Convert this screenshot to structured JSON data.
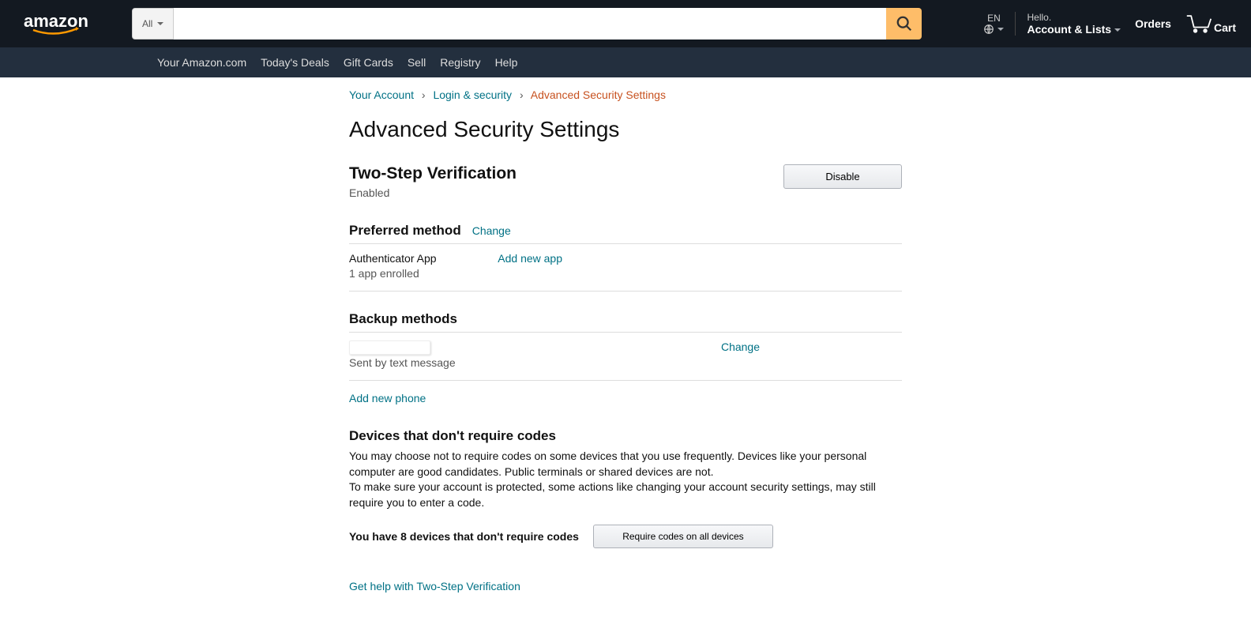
{
  "header": {
    "logo_text": "amazon",
    "search_scope": "All",
    "search_placeholder": "",
    "lang_code": "EN",
    "account_line1": "Hello.",
    "account_line2": "Account & Lists",
    "orders": "Orders",
    "cart": "Cart"
  },
  "subnav": {
    "items": [
      "Your Amazon.com",
      "Today's Deals",
      "Gift Cards",
      "Sell",
      "Registry",
      "Help"
    ]
  },
  "breadcrumb": {
    "your_account": "Your Account",
    "login_security": "Login & security",
    "current": "Advanced Security Settings"
  },
  "page": {
    "title": "Advanced Security Settings",
    "tsv": {
      "heading": "Two-Step Verification",
      "status": "Enabled",
      "disable_btn": "Disable"
    },
    "preferred": {
      "heading": "Preferred method",
      "change": "Change",
      "method_name": "Authenticator App",
      "method_sub": "1 app enrolled",
      "add_new": "Add new app"
    },
    "backup": {
      "heading": "Backup methods",
      "sub": "Sent by text message",
      "change": "Change",
      "add_phone": "Add new phone"
    },
    "devices": {
      "heading": "Devices that don't require codes",
      "body": "You may choose not to require codes on some devices that you use frequently. Devices like your personal computer are good candidates. Public terminals or shared devices are not.\nTo make sure your account is protected, some actions like changing your account security settings, may still require you to enter a code.",
      "count_text": "You have 8 devices that don't require codes",
      "require_btn": "Require codes on all devices"
    },
    "help_link": "Get help with Two-Step Verification"
  }
}
